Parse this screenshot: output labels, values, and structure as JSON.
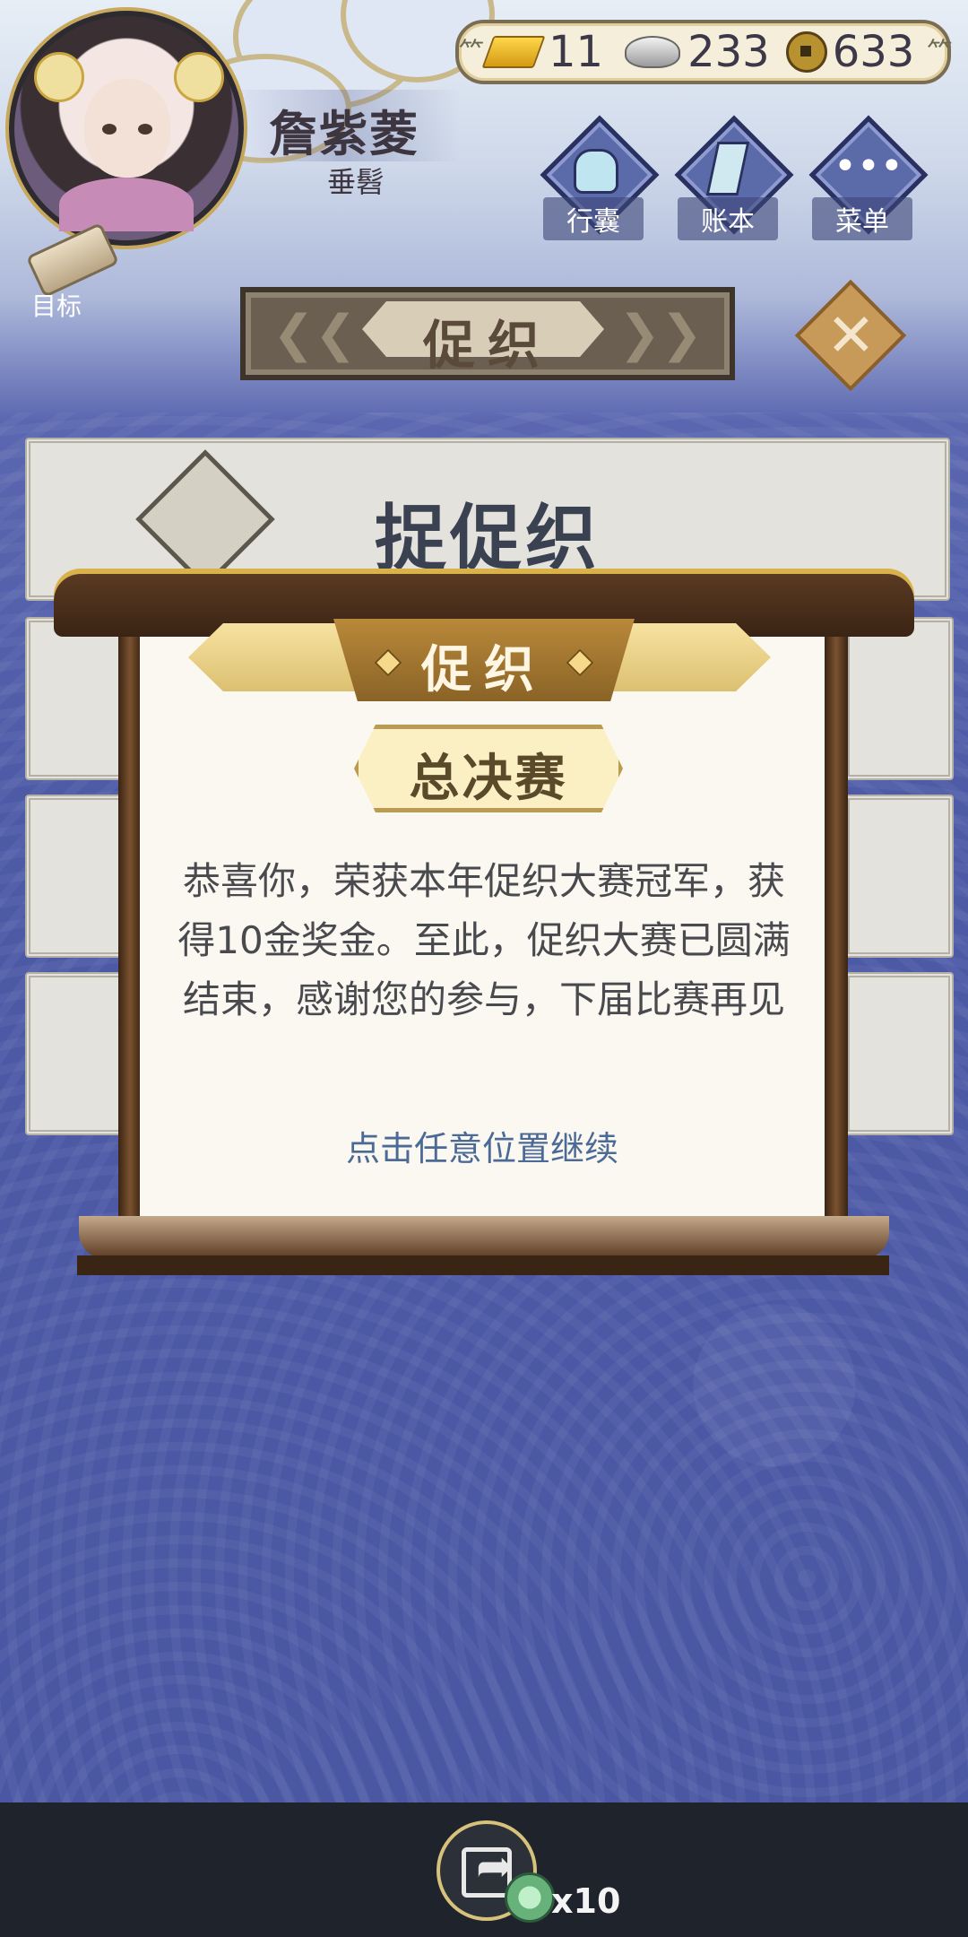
{
  "player": {
    "name": "詹紫菱",
    "title": "垂髫"
  },
  "currency": {
    "gold": "11",
    "silver": "233",
    "coins": "633"
  },
  "topnav": {
    "bag_label": "行囊",
    "ledger_label": "账本",
    "menu_label": "菜单",
    "target_label": "目标"
  },
  "page": {
    "banner_title": "促织",
    "card_title": "捉促织"
  },
  "modal": {
    "header": "促织",
    "badge": "总决赛",
    "message": "恭喜你，荣获本年促织大赛冠军，获得10金奖金。至此，促织大赛已圆满结束，感谢您的参与，下届比赛再见",
    "hint": "点击任意位置继续"
  },
  "bottom": {
    "share_multiplier": "x10"
  },
  "colors": {
    "accent_gold": "#c9a640",
    "modal_wood": "#3a2414",
    "background_blue": "#4d5aa6"
  }
}
